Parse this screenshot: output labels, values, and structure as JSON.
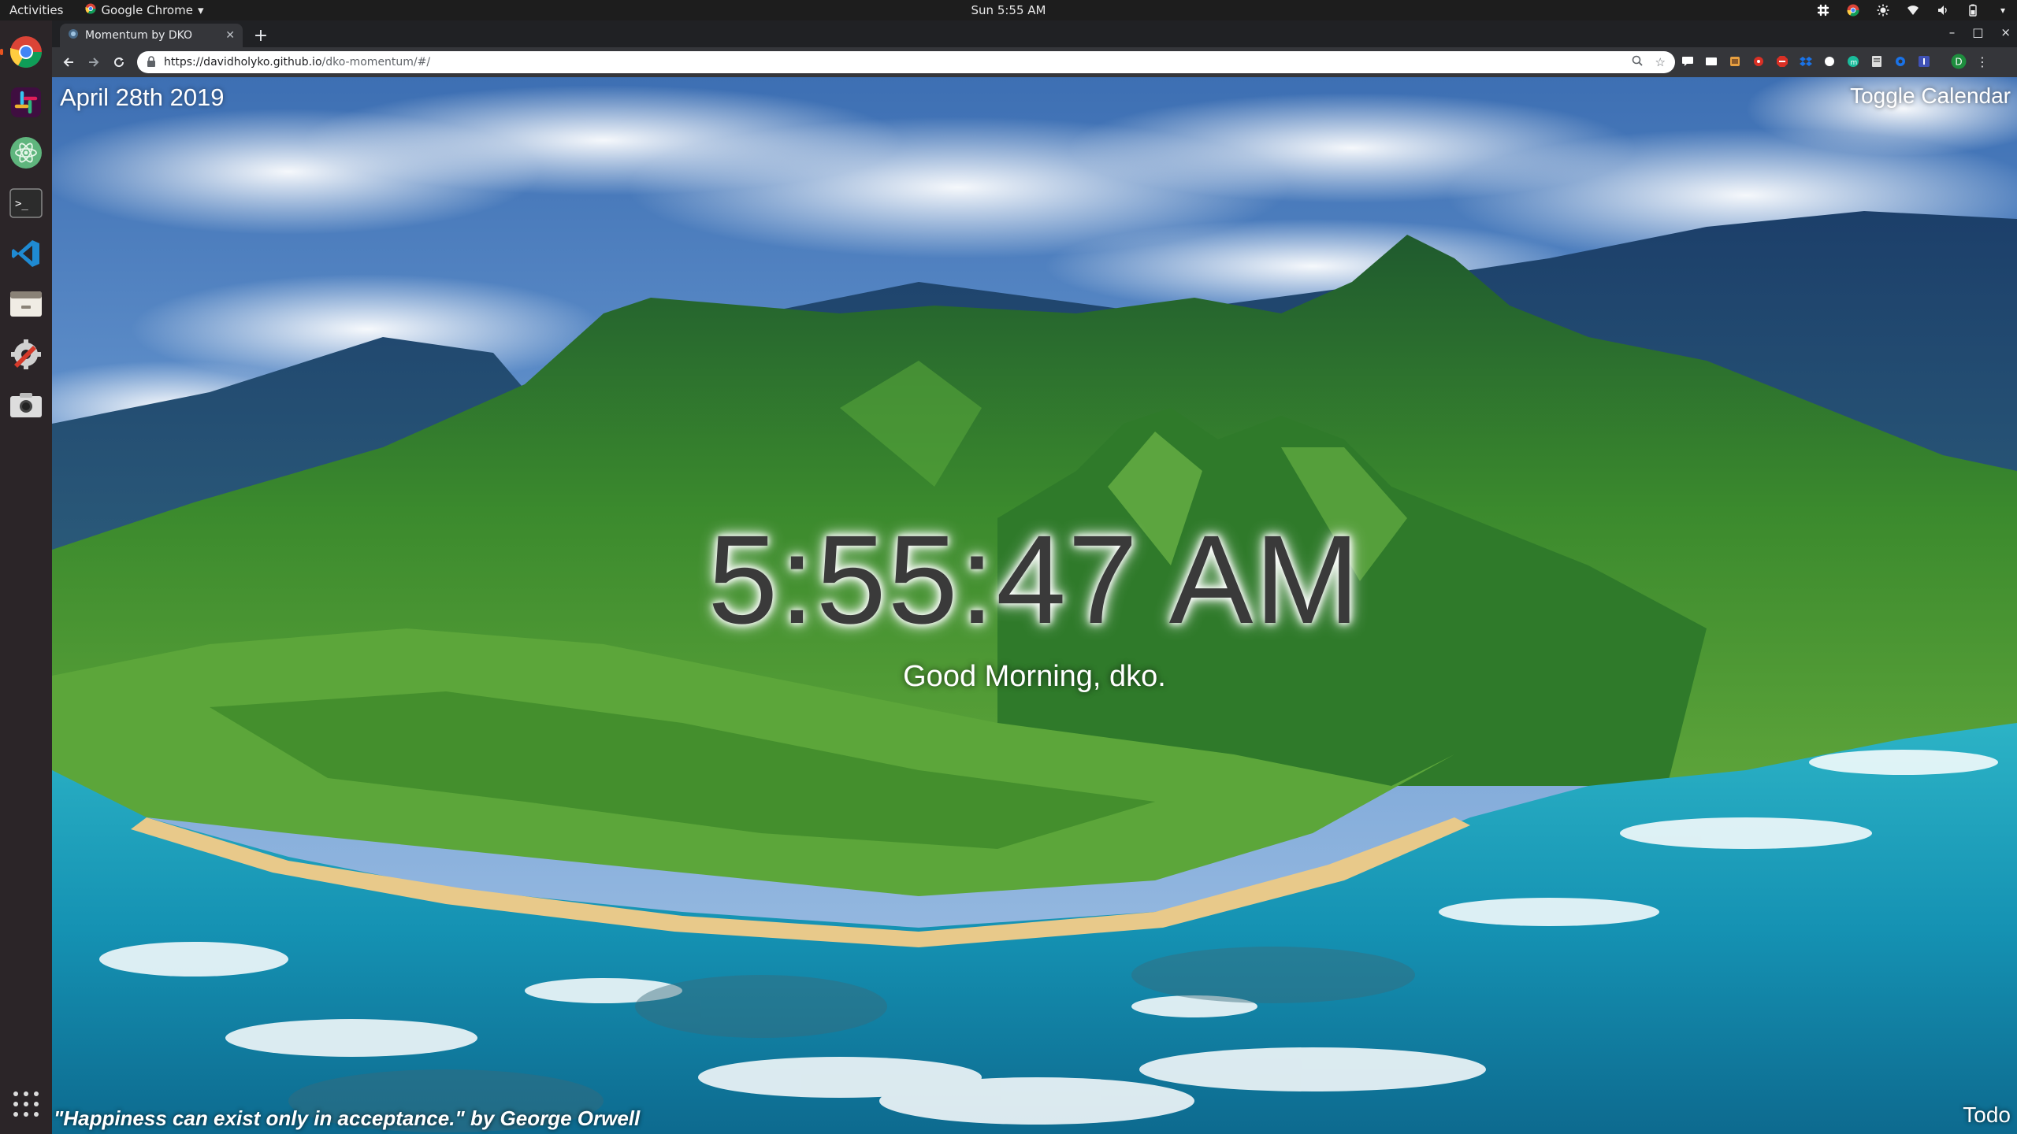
{
  "topbar": {
    "activities": "Activities",
    "app_menu": "Google Chrome",
    "clock": "Sun  5:55 AM",
    "tray_icons": [
      "slack-tray-icon",
      "chrome-tray-icon",
      "brightness-icon",
      "wifi-icon",
      "volume-icon",
      "battery-icon",
      "system-menu-chevron-icon"
    ]
  },
  "dock": {
    "apps": [
      "chrome-icon",
      "slack-icon",
      "atom-icon",
      "terminal-icon",
      "vscode-icon",
      "files-icon",
      "settings-icon",
      "screenshot-icon"
    ],
    "show_apps": "show-applications-icon"
  },
  "browser": {
    "tab_title": "Momentum by DKO",
    "new_tab": "+",
    "url_host": "https://davidholyko.github.io",
    "url_path": "/dko-momentum/#/",
    "window_controls": [
      "–",
      "□",
      "×"
    ],
    "extensions": [
      "#ffffff",
      "#ffffff",
      "#e8a040",
      "#d93025",
      "#d93025",
      "#1a73e8",
      "#ffffff",
      "#1abc9c",
      "#ffffff",
      "#1a73e8",
      "#3f51b5",
      "#1e8e3e"
    ],
    "profile_initial": "D"
  },
  "page": {
    "date": "April 28th 2019",
    "toggle_calendar": "Toggle Calendar",
    "time": "5:55:47 AM",
    "greeting": "Good Morning, dko.",
    "quote": "\"Happiness can exist only in acceptance.\" by George Orwell",
    "todo": "Todo"
  },
  "colors": {
    "sky": "#5a8fc8",
    "mountain": "#3f8a2a",
    "ocean": "#1aa4c0",
    "accent_orange": "#e95420"
  }
}
